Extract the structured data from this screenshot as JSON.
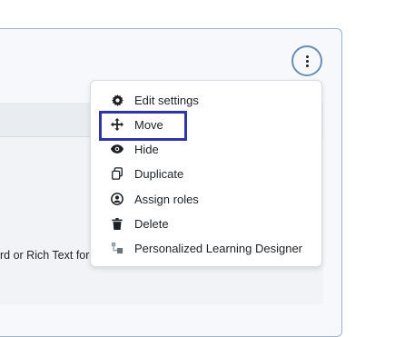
{
  "background_text": {
    "truncated": "rd or Rich Text for"
  },
  "actions_menu": {
    "items": [
      {
        "label": "Edit settings",
        "icon": "gear-icon"
      },
      {
        "label": "Move",
        "icon": "move-arrows-icon"
      },
      {
        "label": "Hide",
        "icon": "eye-icon"
      },
      {
        "label": "Duplicate",
        "icon": "duplicate-icon"
      },
      {
        "label": "Assign roles",
        "icon": "user-circle-icon"
      },
      {
        "label": "Delete",
        "icon": "trash-icon"
      },
      {
        "label": "Personalized Learning Designer",
        "icon": "pld-icon"
      }
    ]
  },
  "colors": {
    "highlight": "#3036a3",
    "kebab_ring": "#6a8db5",
    "card_border": "#9cb6cf"
  }
}
